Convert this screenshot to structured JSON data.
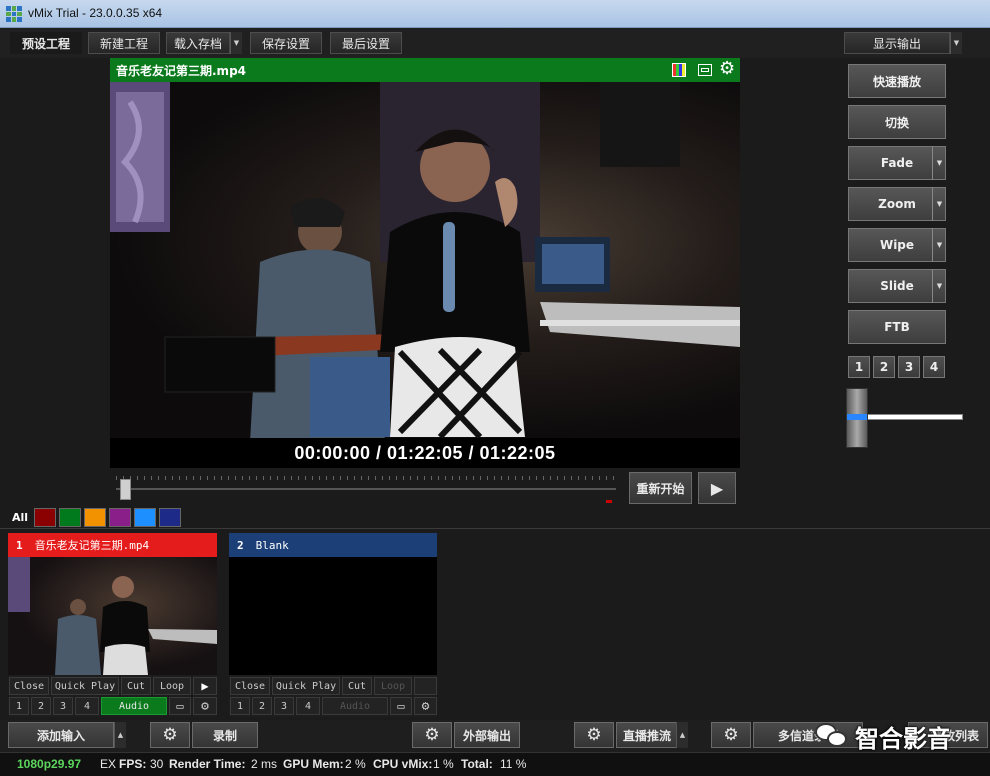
{
  "window": {
    "title": "vMix Trial - 23.0.0.35 x64"
  },
  "menu": {
    "presets": "预设工程",
    "new_project": "新建工程",
    "open": "载入存档",
    "save": "保存设置",
    "last": "最后设置",
    "display_output": "显示输出"
  },
  "preview": {
    "title": "音乐老友记第三期.mp4",
    "timecode": "00:00:00  /  01:22:05  /  01:22:05",
    "restart": "重新开始"
  },
  "transitions": {
    "quick_play": "快速播放",
    "cut": "切换",
    "fade": "Fade",
    "zoom": "Zoom",
    "wipe": "Wipe",
    "slide": "Slide",
    "ftb": "FTB",
    "numbers": [
      "1",
      "2",
      "3",
      "4"
    ]
  },
  "color_tabs": {
    "all_label": "All",
    "colors": [
      "#8b0000",
      "#007a1c",
      "#f39200",
      "#8a1f8a",
      "#1e8fff",
      "#1d2a87"
    ]
  },
  "inputs": [
    {
      "number": "1",
      "name": "音乐老友记第三期.mp4",
      "header_color": "#e51c1c",
      "controls": [
        "Close",
        "Quick Play",
        "Cut",
        "Loop"
      ],
      "layers": [
        "1",
        "2",
        "3",
        "4"
      ],
      "audio": "Audio"
    },
    {
      "number": "2",
      "name": "Blank",
      "header_color": "#1d3f78",
      "controls": [
        "Close",
        "Quick Play",
        "Cut",
        "Loop"
      ],
      "layers": [
        "1",
        "2",
        "3",
        "4"
      ],
      "audio": "Audio"
    }
  ],
  "bottom": {
    "add_input": "添加输入",
    "record": "录制",
    "external": "外部输出",
    "stream": "直播推流",
    "multicorder": "多信道录制",
    "playlist": "播放列表"
  },
  "watermark": "智合影音",
  "status": {
    "format": "1080p29.97",
    "ex": "EX",
    "fps_label": "FPS:",
    "fps": "30",
    "render_label": "Render Time:",
    "render": "2 ms",
    "gpu_label": "GPU Mem:",
    "gpu": "2 %",
    "cpu_label": "CPU vMix:",
    "cpu": "1 %",
    "total_label": "Total:",
    "total": "11 %"
  }
}
